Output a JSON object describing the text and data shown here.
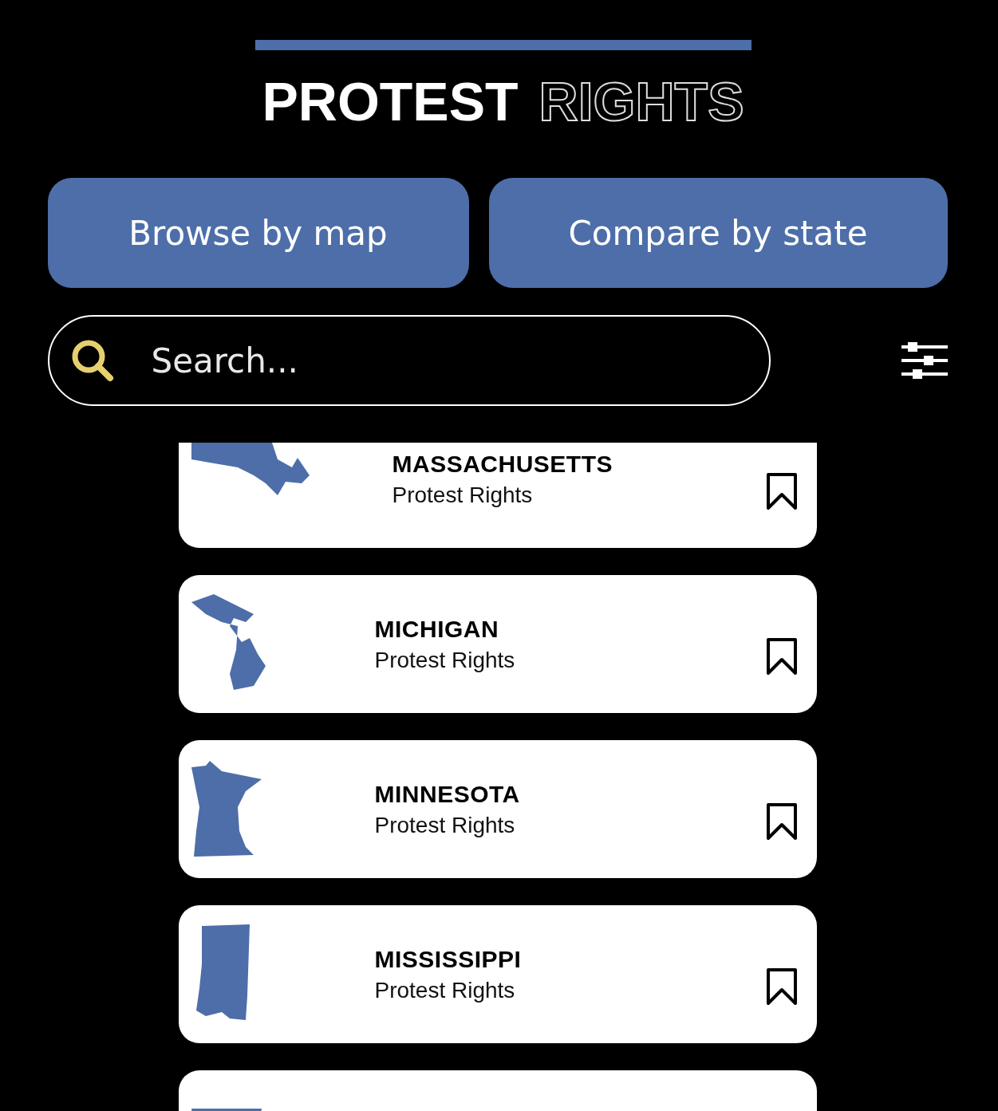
{
  "header": {
    "title_bold": "PROTEST",
    "title_outline": "RIGHTS"
  },
  "buttons": [
    {
      "label": "Browse by map"
    },
    {
      "label": "Compare by state"
    }
  ],
  "search": {
    "placeholder": "Search..."
  },
  "states": [
    {
      "kind": "state",
      "name": "MASSACHUSETTS",
      "subtitle": "Protest Rights",
      "bookmarked": false
    },
    {
      "kind": "state",
      "name": "MICHIGAN",
      "subtitle": "Protest Rights",
      "bookmarked": false
    },
    {
      "kind": "state",
      "name": "MINNESOTA",
      "subtitle": "Protest Rights",
      "bookmarked": false
    },
    {
      "kind": "state",
      "name": "MISSISSIPPI",
      "subtitle": "Protest Rights",
      "bookmarked": false
    },
    {
      "kind": "partial"
    }
  ]
}
